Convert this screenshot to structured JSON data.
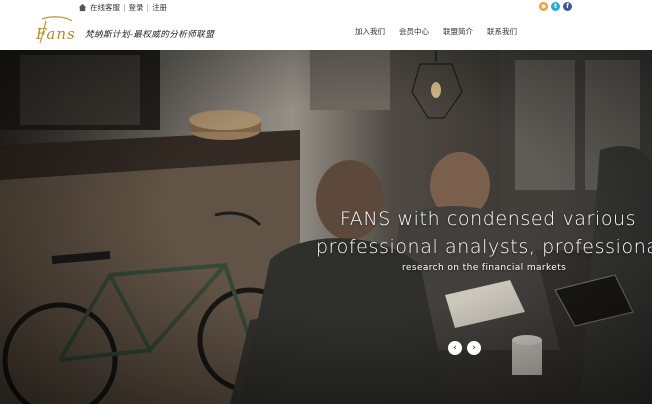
{
  "topbar": {
    "links": [
      "在线客服",
      "登录",
      "注册"
    ],
    "separator": "|",
    "social": [
      {
        "name": "rss-icon",
        "glyph": "◉",
        "color": "#f0a030"
      },
      {
        "name": "twitter-icon",
        "glyph": "t",
        "color": "#29a9e0"
      },
      {
        "name": "facebook-icon",
        "glyph": "f",
        "color": "#3b5998"
      }
    ]
  },
  "header": {
    "logo_text": "Fans",
    "slogan": "梵纳斯计划-最权威的分析师联盟",
    "nav": [
      "加入我们",
      "会员中心",
      "联盟简介",
      "联系我们"
    ]
  },
  "hero": {
    "title_line1": "FANS with condensed various",
    "title_line2": "professional analysts, professiona",
    "subtitle": "research on the financial markets",
    "prev_glyph": "‹",
    "next_glyph": "›"
  }
}
